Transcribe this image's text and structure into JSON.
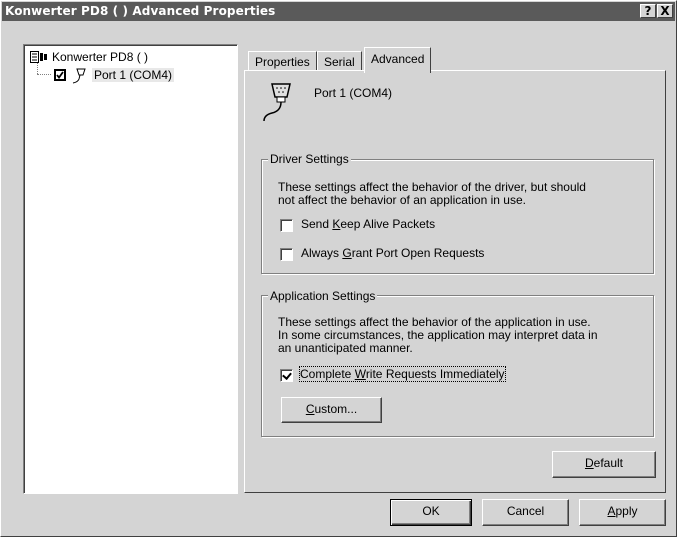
{
  "window": {
    "title": "Konwerter PD8 ( ) Advanced Properties",
    "help_label": "?",
    "close_label": "X"
  },
  "tree": {
    "root_label": "Konwerter PD8 ( )",
    "child_label": "Port 1 (COM4)",
    "child_checked": true
  },
  "tabs": [
    {
      "label": "Properties",
      "active": false
    },
    {
      "label": "Serial",
      "active": false
    },
    {
      "label": "Advanced",
      "active": true
    }
  ],
  "device": {
    "name": "Port 1 (COM4)",
    "icon": "serial-port-icon"
  },
  "driver_settings": {
    "title": "Driver Settings",
    "description_line1": "These settings affect the behavior of the driver, but should",
    "description_line2": "not affect the behavior of an application in use.",
    "keep_alive": {
      "pre": "Send ",
      "accel": "K",
      "post": "eep Alive Packets",
      "checked": false
    },
    "grant_open": {
      "pre": "Always ",
      "accel": "G",
      "post": "rant Port Open Requests",
      "checked": false
    }
  },
  "application_settings": {
    "title": "Application Settings",
    "description_line1": "These settings affect the behavior of the application in use.",
    "description_line2": "In some circumstances, the application may interpret data in",
    "description_line3": "an unanticipated manner.",
    "complete_write": {
      "pre": "Complete ",
      "accel": "W",
      "post": "rite Requests Immediately",
      "checked": true
    },
    "custom_button": {
      "pre": "",
      "accel": "C",
      "post": "ustom..."
    }
  },
  "default_button": {
    "pre": "",
    "accel": "D",
    "post": "efault"
  },
  "footer": {
    "ok_label": "OK",
    "cancel_label": "Cancel",
    "apply": {
      "pre": "",
      "accel": "A",
      "post": "pply"
    }
  }
}
